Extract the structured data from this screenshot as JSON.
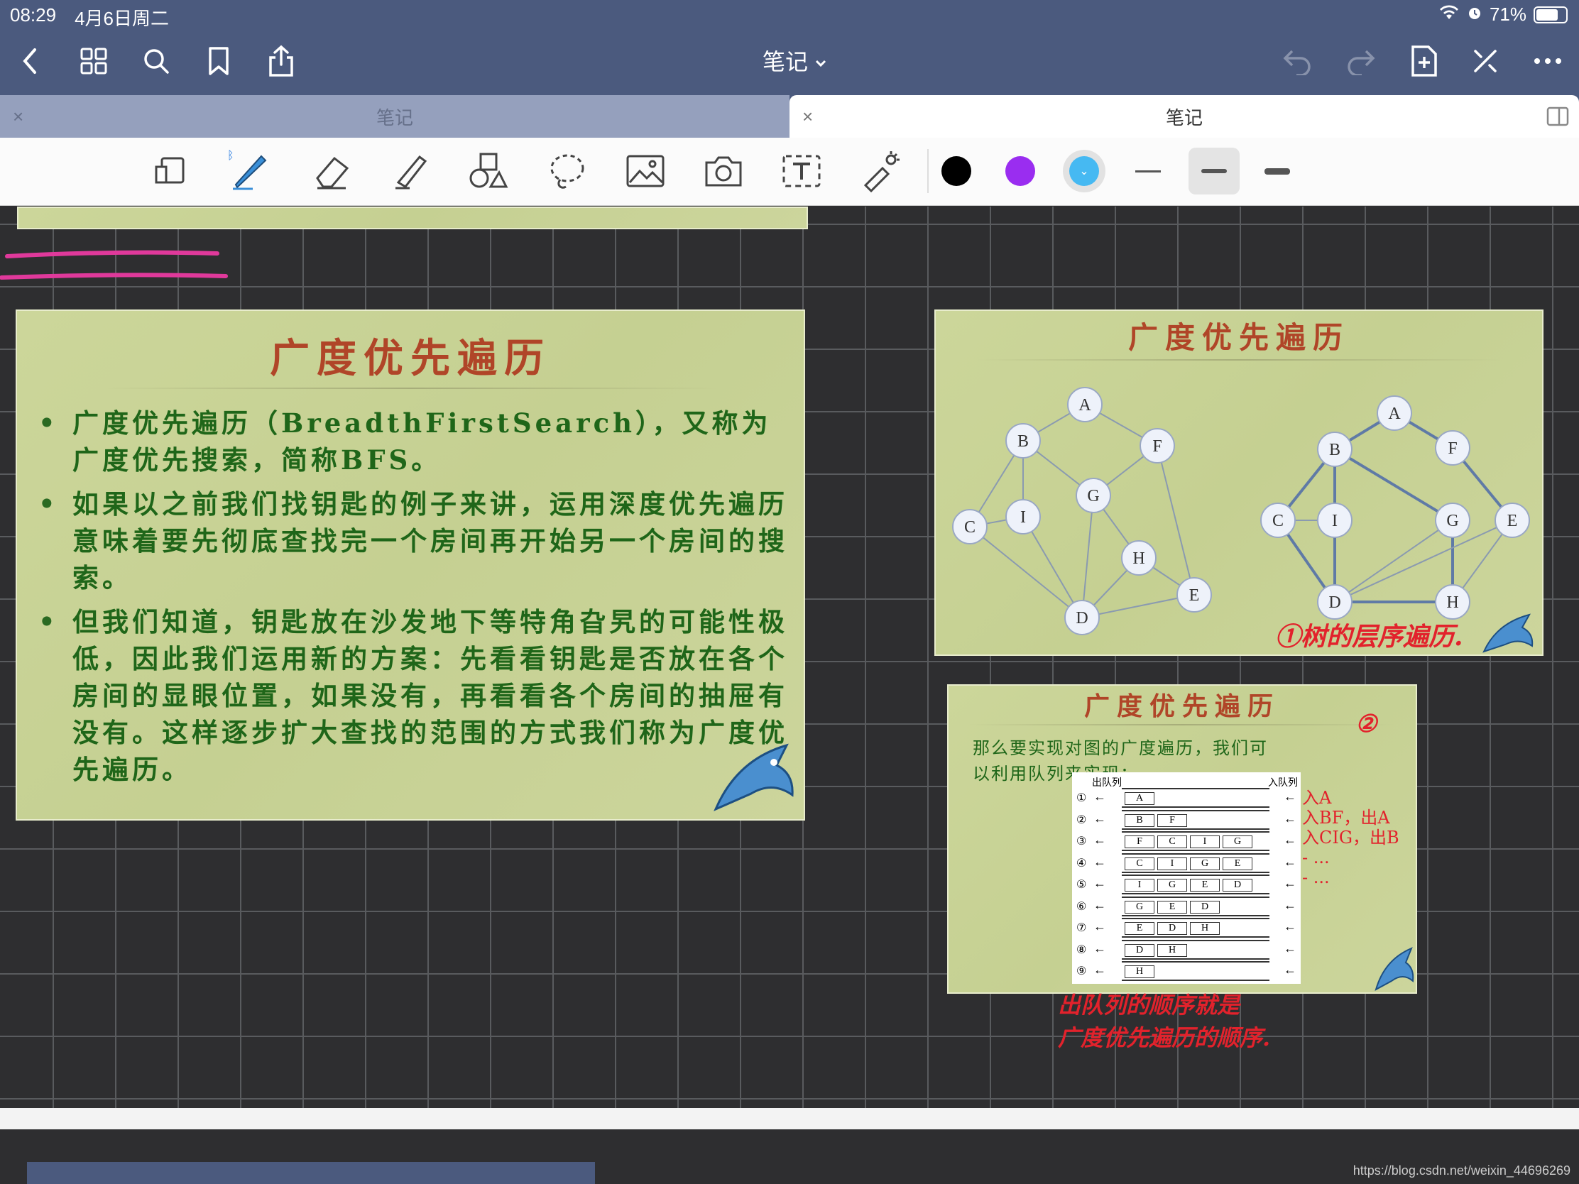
{
  "status": {
    "time": "08:29",
    "date": "4月6日周二",
    "battery": "71%"
  },
  "topbar": {
    "title": "笔记"
  },
  "tabs": [
    {
      "label": "笔记",
      "close": "×"
    },
    {
      "label": "笔记",
      "close": "×"
    }
  ],
  "slide_main": {
    "title": "广度优先遍历",
    "bullets": [
      "广度优先遍历（BreadthFirstSearch），又称为广度优先搜索，简称BFS。",
      "如果以之前我们找钥匙的例子来讲，运用深度优先遍历意味着要先彻底查找完一个房间再开始另一个房间的搜索。",
      "但我们知道，钥匙放在沙发地下等特角旮旯的可能性极低，因此我们运用新的方案：先看看钥匙是否放在各个房间的显眼位置，如果没有，再看看各个房间的抽屉有没有。这样逐步扩大查找的范围的方式我们称为广度优先遍历。"
    ]
  },
  "slide_graph": {
    "title": "广度优先遍历",
    "left_nodes": [
      "A",
      "B",
      "F",
      "G",
      "C",
      "I",
      "H",
      "D",
      "E"
    ],
    "right_nodes": [
      "A",
      "B",
      "F",
      "C",
      "I",
      "G",
      "E",
      "D",
      "H"
    ],
    "note": "①树的层序遍历."
  },
  "slide_queue": {
    "title": "广度优先遍历",
    "text": "那么要实现对图的广度遍历，我们可以利用队列来实现：",
    "circled": "②",
    "label_out": "出队列",
    "label_in": "入队列",
    "steps": [
      "①",
      "②",
      "③",
      "④",
      "⑤",
      "⑥",
      "⑦",
      "⑧",
      "⑨"
    ],
    "rows": [
      [
        "A"
      ],
      [
        "B",
        "F"
      ],
      [
        "F",
        "C",
        "I",
        "G"
      ],
      [
        "C",
        "I",
        "G",
        "E"
      ],
      [
        "I",
        "G",
        "E",
        "D"
      ],
      [
        "G",
        "E",
        "D"
      ],
      [
        "E",
        "D",
        "H"
      ],
      [
        "D",
        "H"
      ],
      [
        "H"
      ]
    ],
    "notes": [
      "入A",
      "入BF，出A",
      "入CIG，出B",
      "- ...",
      "- ..."
    ]
  },
  "bottom_note": {
    "line1": "出队列的顺序就是",
    "line2": "广度优先遍历的顺序."
  },
  "watermark": "https://blog.csdn.net/weixin_44696269",
  "colors": {
    "bar": "#4b5a7e",
    "slide": "#c8d396",
    "title": "#b04528",
    "text": "#1f6619",
    "ink": "#e2222c",
    "pen_pink": "#e0399b"
  }
}
